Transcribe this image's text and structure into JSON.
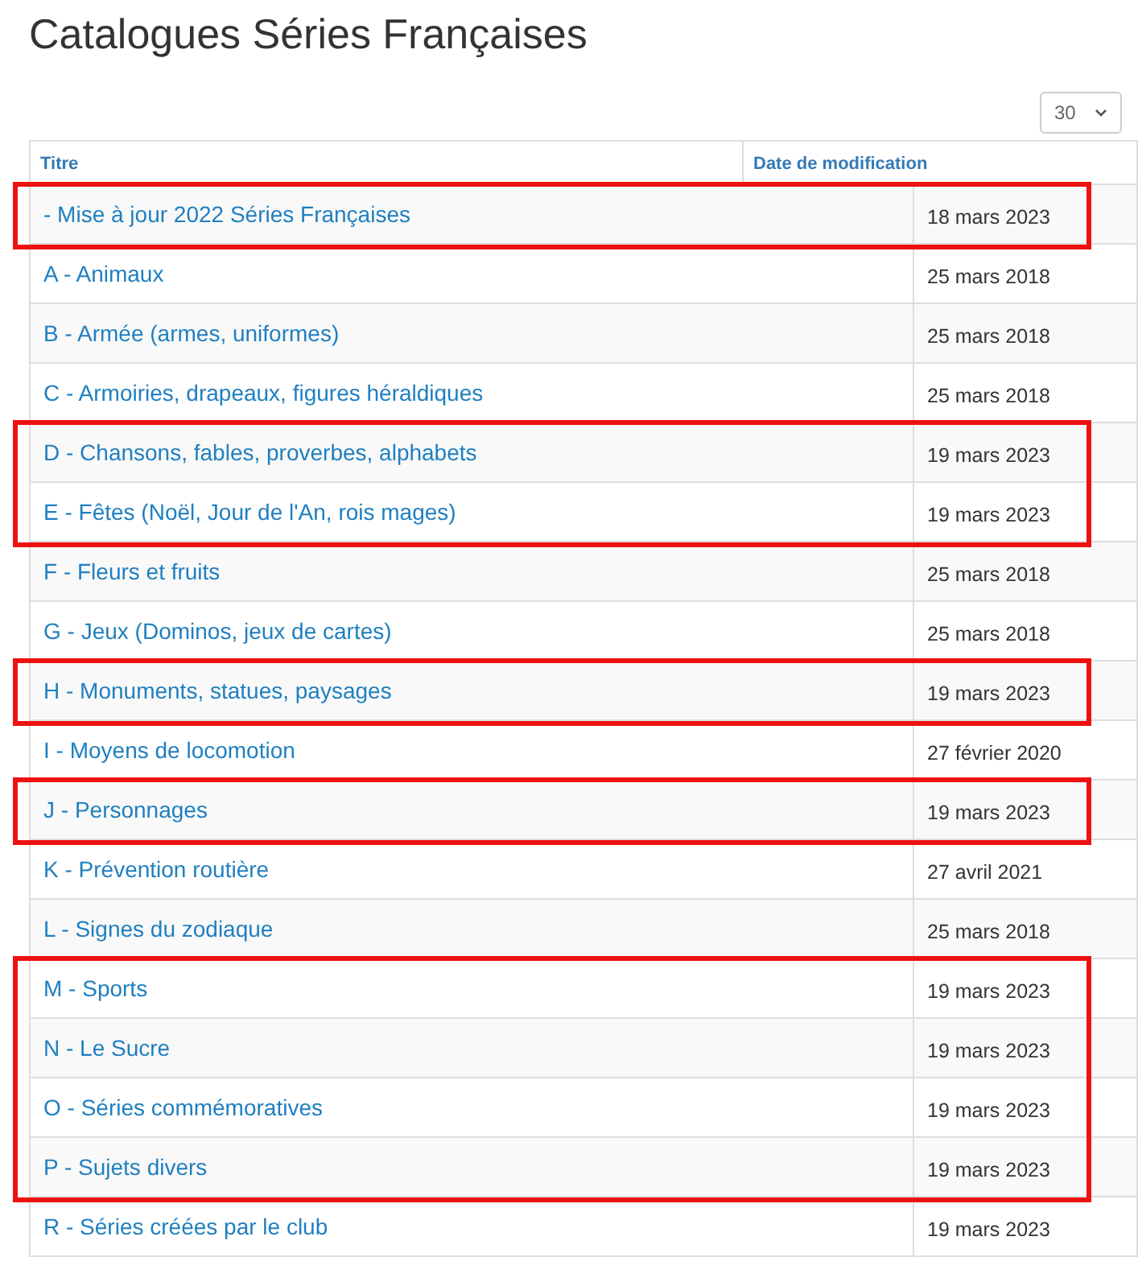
{
  "title": "Catalogues Séries Françaises",
  "page_size": {
    "value": "30"
  },
  "table": {
    "columns": [
      "Titre",
      "Date de modification"
    ],
    "rows": [
      {
        "title": "- Mise à jour 2022 Séries Françaises",
        "date": "18 mars 2023",
        "marked": true
      },
      {
        "title": "A - Animaux",
        "date": "25 mars 2018",
        "marked": false
      },
      {
        "title": "B - Armée (armes, uniformes)",
        "date": "25 mars 2018",
        "marked": false
      },
      {
        "title": "C - Armoiries, drapeaux, figures héraldiques",
        "date": "25 mars 2018",
        "marked": false
      },
      {
        "title": "D - Chansons, fables, proverbes, alphabets",
        "date": "19 mars 2023",
        "marked": true
      },
      {
        "title": "E - Fêtes (Noël, Jour de l'An, rois mages)",
        "date": "19 mars 2023",
        "marked": true
      },
      {
        "title": "F - Fleurs et fruits",
        "date": "25 mars 2018",
        "marked": false
      },
      {
        "title": "G - Jeux (Dominos, jeux de cartes)",
        "date": "25 mars 2018",
        "marked": false
      },
      {
        "title": "H - Monuments, statues, paysages",
        "date": "19 mars 2023",
        "marked": true
      },
      {
        "title": "I - Moyens de locomotion",
        "date": "27 février 2020",
        "marked": false
      },
      {
        "title": "J - Personnages",
        "date": "19 mars 2023",
        "marked": true
      },
      {
        "title": "K - Prévention routière",
        "date": "27 avril 2021",
        "marked": false
      },
      {
        "title": "L - Signes du zodiaque",
        "date": "25 mars 2018",
        "marked": false
      },
      {
        "title": "M - Sports",
        "date": "19 mars 2023",
        "marked": true
      },
      {
        "title": "N - Le Sucre",
        "date": "19 mars 2023",
        "marked": true
      },
      {
        "title": "O - Séries commémoratives",
        "date": "19 mars 2023",
        "marked": true
      },
      {
        "title": "P - Sujets divers",
        "date": "19 mars 2023",
        "marked": true
      },
      {
        "title": "R - Séries créées par le club",
        "date": "19 mars 2023",
        "marked": false
      }
    ]
  }
}
